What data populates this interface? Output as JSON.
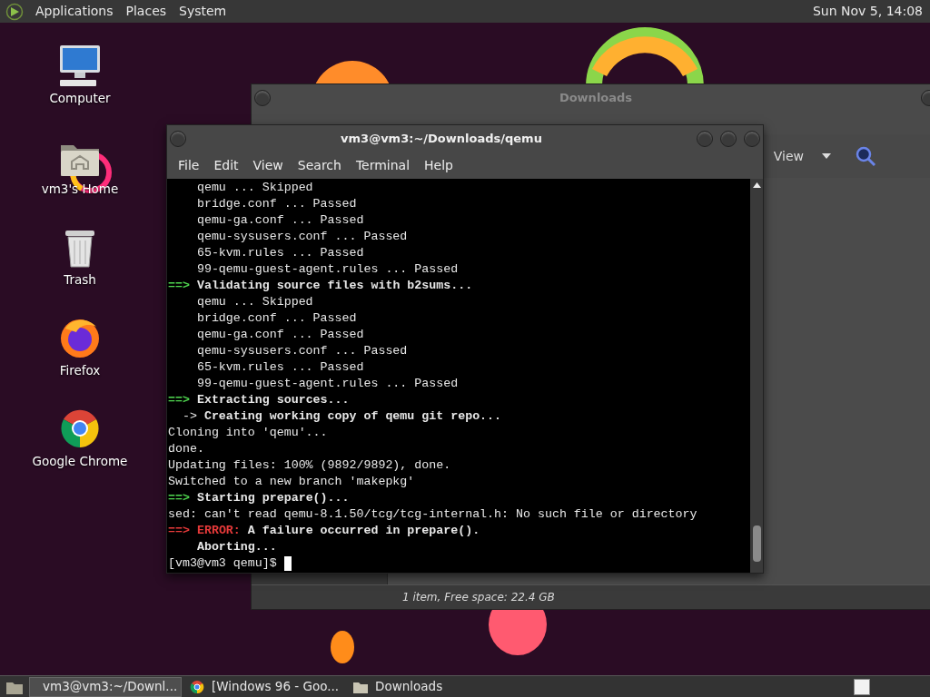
{
  "top_panel": {
    "menus": [
      "Applications",
      "Places",
      "System"
    ],
    "clock": "Sun Nov 5, 14:08"
  },
  "desktop_icons": [
    {
      "kind": "computer",
      "label": "Computer"
    },
    {
      "kind": "home",
      "label": "vm3's Home"
    },
    {
      "kind": "trash",
      "label": "Trash"
    },
    {
      "kind": "globe",
      "label": "Firefox"
    },
    {
      "kind": "pinwheel",
      "label": "Google Chrome"
    }
  ],
  "file_manager": {
    "title": "Downloads",
    "view_button": "View",
    "status": "1 item, Free space: 22.4 GB"
  },
  "terminal": {
    "title": "vm3@vm3:~/Downloads/qemu",
    "menus": [
      "File",
      "Edit",
      "View",
      "Search",
      "Terminal",
      "Help"
    ],
    "lines": [
      {
        "kind": "plain",
        "text": "    qemu ... Skipped"
      },
      {
        "kind": "plain",
        "text": "    bridge.conf ... Passed"
      },
      {
        "kind": "plain",
        "text": "    qemu-ga.conf ... Passed"
      },
      {
        "kind": "plain",
        "text": "    qemu-sysusers.conf ... Passed"
      },
      {
        "kind": "plain",
        "text": "    65-kvm.rules ... Passed"
      },
      {
        "kind": "plain",
        "text": "    99-qemu-guest-agent.rules ... Passed"
      },
      {
        "kind": "step",
        "marker": "==>",
        "text": "Validating source files with b2sums..."
      },
      {
        "kind": "plain",
        "text": "    qemu ... Skipped"
      },
      {
        "kind": "plain",
        "text": "    bridge.conf ... Passed"
      },
      {
        "kind": "plain",
        "text": "    qemu-ga.conf ... Passed"
      },
      {
        "kind": "plain",
        "text": "    qemu-sysusers.conf ... Passed"
      },
      {
        "kind": "plain",
        "text": "    65-kvm.rules ... Passed"
      },
      {
        "kind": "plain",
        "text": "    99-qemu-guest-agent.rules ... Passed"
      },
      {
        "kind": "step",
        "marker": "==>",
        "text": "Extracting sources..."
      },
      {
        "kind": "substep",
        "marker": "  ->",
        "text": "Creating working copy of qemu git repo..."
      },
      {
        "kind": "plain",
        "text": "Cloning into 'qemu'..."
      },
      {
        "kind": "plain",
        "text": "done."
      },
      {
        "kind": "plain",
        "text": "Updating files: 100% (9892/9892), done."
      },
      {
        "kind": "plain",
        "text": "Switched to a new branch 'makepkg'"
      },
      {
        "kind": "step",
        "marker": "==>",
        "text": "Starting prepare()..."
      },
      {
        "kind": "plain",
        "text": "sed: can't read qemu-8.1.50/tcg/tcg-internal.h: No such file or directory"
      },
      {
        "kind": "error",
        "marker": "==>",
        "label": "ERROR:",
        "text": "A failure occurred in prepare()."
      },
      {
        "kind": "bold",
        "text": "    Aborting..."
      },
      {
        "kind": "prompt",
        "text": "[vm3@vm3 qemu]$"
      }
    ]
  },
  "taskbar": {
    "items": [
      {
        "kind": "terminal",
        "label": "vm3@vm3:~/Downl...",
        "selected": true
      },
      {
        "kind": "browser",
        "label": "[Windows 96 - Goo...",
        "selected": false
      },
      {
        "kind": "folder",
        "label": "Downloads",
        "selected": false
      }
    ]
  }
}
